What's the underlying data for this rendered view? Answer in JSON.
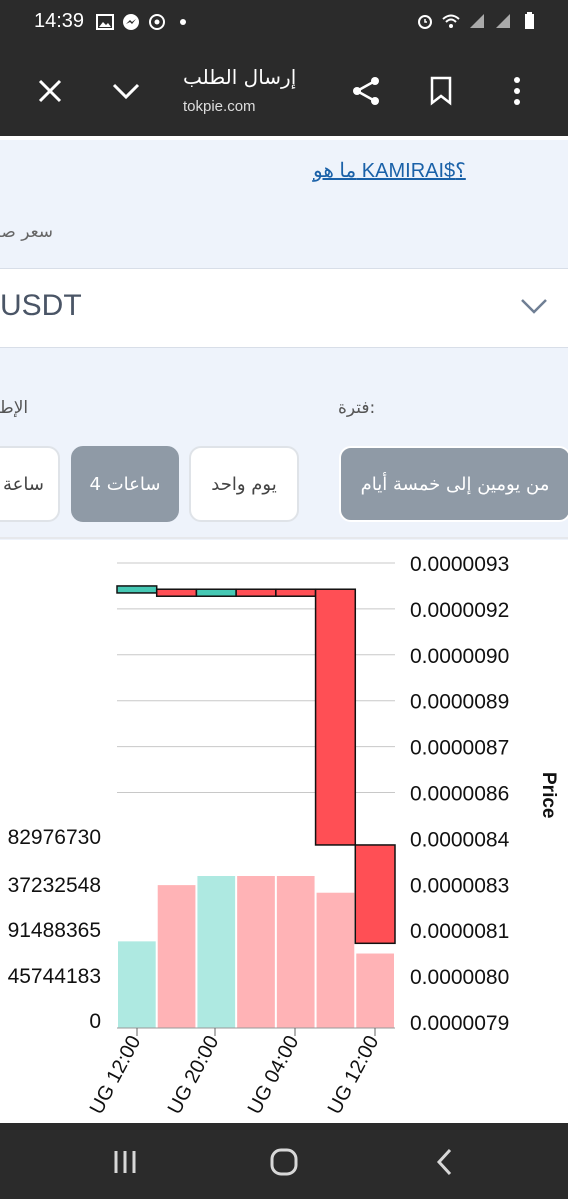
{
  "status_bar": {
    "time": "14:39",
    "icons_left": [
      "gallery-icon",
      "messenger-icon",
      "assistant-icon",
      "dot-icon"
    ],
    "icons_right": [
      "alarm-icon",
      "wifi-icon",
      "signal-icon",
      "signal-icon",
      "battery-icon"
    ]
  },
  "toolbar": {
    "title": "إرسال الطلب",
    "url": "tokpie.com",
    "close_icon": "close-icon",
    "collapse_icon": "chevron-down-icon",
    "share_icon": "share-icon",
    "bookmark_icon": "bookmark-icon",
    "menu_icon": "more-vertical-icon"
  },
  "page": {
    "whatis_link": "ما هو KAMIRAI$؟",
    "pair_label": "سعر صر",
    "pair_select_value": "USDT",
    "total_label": "الإط",
    "period_label": "فترة:",
    "periods": [
      {
        "label": "من يومين إلى خمسة أيام",
        "state": "selected"
      },
      {
        "label": "يوم واحد",
        "state": "plain"
      },
      {
        "label": "4 ساعات",
        "state": "active"
      },
      {
        "label": "ساعة",
        "state": "plain"
      }
    ]
  },
  "chart_data": {
    "type": "candlestick",
    "price_axis_label": "Price",
    "price_ticks": [
      "0.0000093",
      "0.0000092",
      "0.0000090",
      "0.0000089",
      "0.0000087",
      "0.0000086",
      "0.0000084",
      "0.0000083",
      "0.0000081",
      "0.0000080",
      "0.0000079"
    ],
    "volume_ticks": [
      "82976730",
      "37232548",
      "91488365",
      "45744183",
      "0"
    ],
    "x_ticks": [
      "UG 12:00",
      "UG 20:00",
      "UG 04:00",
      "UG 12:00"
    ],
    "colors": {
      "up": "#46c8b4",
      "down": "#ff4f55",
      "up_volume": "#aee9e1",
      "down_volume": "#ffb3b6",
      "grid": "#c8c8c8"
    },
    "candles": [
      {
        "open": 9.22e-06,
        "close": 9.23e-06,
        "direction": "up"
      },
      {
        "open": 9.22e-06,
        "close": 9.21e-06,
        "direction": "down"
      },
      {
        "open": 9.21e-06,
        "close": 9.22e-06,
        "direction": "up"
      },
      {
        "open": 9.22e-06,
        "close": 9.21e-06,
        "direction": "down"
      },
      {
        "open": 9.22e-06,
        "close": 9.21e-06,
        "direction": "down"
      },
      {
        "open": 9.22e-06,
        "close": 8.44e-06,
        "direction": "down"
      },
      {
        "open": 8.44e-06,
        "close": 8.14e-06,
        "direction": "down"
      }
    ],
    "volume_relative": [
      0.57,
      0.94,
      1.0,
      1.0,
      1.0,
      0.89,
      0.49
    ]
  },
  "navbar": {
    "recents_icon": "recents-icon",
    "home_icon": "home-icon",
    "back_icon": "back-icon"
  }
}
